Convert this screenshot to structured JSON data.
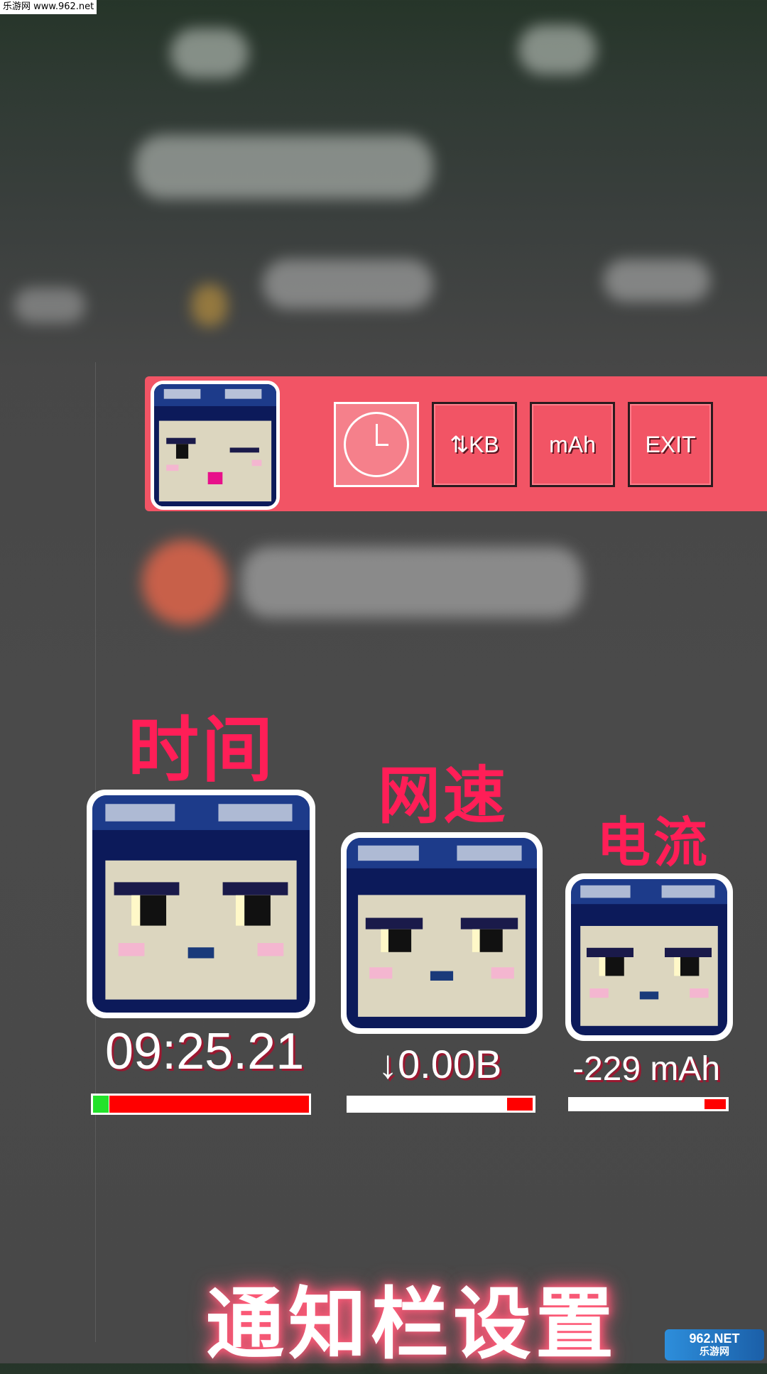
{
  "watermark_top": "乐游网 www.962.net",
  "toolbar": {
    "buttons": [
      {
        "label": "",
        "icon": "clock-icon",
        "active": true
      },
      {
        "label": "⇅KB"
      },
      {
        "label": "mAh"
      },
      {
        "label": "EXIT"
      }
    ]
  },
  "widgets": {
    "time": {
      "label": "时间",
      "value": "09:25.21"
    },
    "net": {
      "label": "网速",
      "value": "↓0.00B"
    },
    "current": {
      "label": "电流",
      "value": "-229 mAh"
    }
  },
  "footer": {
    "title": "通知栏设置"
  },
  "watermark_bottom": {
    "line1": "962.NET",
    "line2": "乐游网"
  },
  "colors": {
    "accent": "#f25465",
    "label": "#ff1e57",
    "bar_fill": "#ff0000",
    "bar_start": "#22e22a"
  }
}
